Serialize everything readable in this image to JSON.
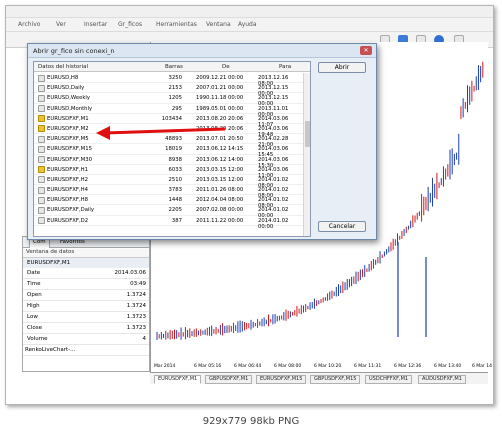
{
  "menu": [
    "Archivo",
    "Ver",
    "Insertar",
    "Gr_ficos",
    "Herramientas",
    "Ventana",
    "Ayuda"
  ],
  "dialog": {
    "title": "Abrir gr_fico sin conexi_n",
    "columns": {
      "name": "Datos del historial",
      "bars": "Barras",
      "from": "De",
      "to": "Para"
    },
    "rows": [
      {
        "name": "EURUSD,H8",
        "bars": "3250",
        "from": "2009.12.21 00:00",
        "to": "2013.12.16 08:00",
        "icon": "grey"
      },
      {
        "name": "EURUSD,Daily",
        "bars": "2153",
        "from": "2007.01.21 00:00",
        "to": "2013.12.15 00:00",
        "icon": "grey"
      },
      {
        "name": "EURUSD,Weekly",
        "bars": "1205",
        "from": "1990.11.18 00:00",
        "to": "2013.12.15 00:00",
        "icon": "grey"
      },
      {
        "name": "EURUSD,Monthly",
        "bars": "295",
        "from": "1989.05.01 00:00",
        "to": "2013.11.01 00:00",
        "icon": "grey"
      },
      {
        "name": "EURUSDFXF,M1",
        "bars": "103434",
        "from": "2013.08.20 20:06",
        "to": "2014.03.06 11:07",
        "icon": "yellow"
      },
      {
        "name": "EURUSDFXF,M2",
        "bars": "",
        "from": "2013.08.20 20:06",
        "to": "2014.03.06 19:48",
        "icon": "yellow"
      },
      {
        "name": "EURUSDFXF,M5",
        "bars": "48893",
        "from": "2013.07.01 20:50",
        "to": "2014.02.28 21:00",
        "icon": "grey"
      },
      {
        "name": "EURUSDFXF,M15",
        "bars": "18019",
        "from": "2013.06.12 14:15",
        "to": "2014.03.06 15:45",
        "icon": "grey"
      },
      {
        "name": "EURUSDFXF,M30",
        "bars": "8938",
        "from": "2013.06.12 14:00",
        "to": "2014.03.06 15:30",
        "icon": "grey"
      },
      {
        "name": "EURUSDFXF,H1",
        "bars": "6033",
        "from": "2013.03.15 12:00",
        "to": "2014.03.06 11:00",
        "icon": "yellow"
      },
      {
        "name": "EURUSDFXF,H2",
        "bars": "2510",
        "from": "2013.03.15 12:00",
        "to": "2014.01.02 08:00",
        "icon": "grey"
      },
      {
        "name": "EURUSDFXF,H4",
        "bars": "3783",
        "from": "2011.01.26 08:00",
        "to": "2014.01.02 08:00",
        "icon": "grey"
      },
      {
        "name": "EURUSDFXF,H8",
        "bars": "1448",
        "from": "2012.04.04 08:00",
        "to": "2014.01.02 08:00",
        "icon": "grey"
      },
      {
        "name": "EURUSDFXF,Daily",
        "bars": "2205",
        "from": "2007.02.08 00:00",
        "to": "2014.01.02 00:00",
        "icon": "grey"
      },
      {
        "name": "EURUSDFXF,D2",
        "bars": "387",
        "from": "2011.11.22 00:00",
        "to": "2014.01.02 00:00",
        "icon": "grey"
      }
    ],
    "open_label": "Abrir",
    "cancel_label": "Cancelar"
  },
  "left_panel": {
    "tabs": [
      "Com",
      "Favoritos"
    ],
    "header": "Ventana de datos",
    "symbol": "EURUSDFXF,M1",
    "data": [
      {
        "label": "Date",
        "value": "2014.03.06"
      },
      {
        "label": "Time",
        "value": "03:49"
      },
      {
        "label": "Open",
        "value": "1.3724"
      },
      {
        "label": "High",
        "value": "1.3724"
      },
      {
        "label": "Low",
        "value": "1.3723"
      },
      {
        "label": "Close",
        "value": "1.3723"
      },
      {
        "label": "Volume",
        "value": "4"
      }
    ],
    "indicator": "RenkoLiveChart-..."
  },
  "chart": {
    "x_labels": [
      "Mar 2014",
      "6 Mar 05:16",
      "6 Mar 06:44",
      "6 Mar 08:00",
      "6 Mar 10:20",
      "6 Mar 11:31",
      "6 Mar 12:36",
      "6 Mar 13:40",
      "6 Mar 14"
    ],
    "tabs": [
      "EURUSDFXF,M1",
      "GBPUSDFXF,M1",
      "EURUSDFXF,M15",
      "GBPUSDFXF,M15",
      "USDCHFFXF,M1",
      "AUDUSDFXF,M1"
    ]
  },
  "caption": "929x779  98kb  PNG",
  "colors": {
    "dialog_bg": "#e8eef6",
    "arrow": "#e01010",
    "candle_up": "#1a3fb0",
    "candle_down": "#d01818"
  }
}
